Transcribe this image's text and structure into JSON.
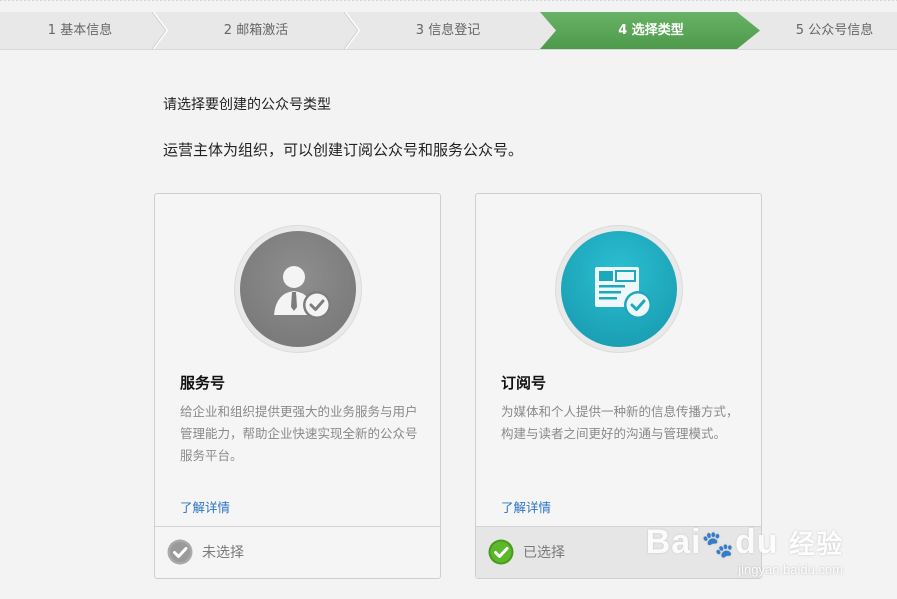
{
  "steps": [
    {
      "label": "1 基本信息"
    },
    {
      "label": "2 邮箱激活"
    },
    {
      "label": "3 信息登记"
    },
    {
      "label": "4 选择类型"
    },
    {
      "label": "5 公众号信息"
    }
  ],
  "active_step_color": "#5aa658",
  "intro": {
    "line1": "请选择要创建的公众号类型",
    "line2": "运营主体为组织，可以创建订阅公众号和服务公众号。"
  },
  "cards": [
    {
      "title": "服务号",
      "desc": "给企业和组织提供更强大的业务服务与用户管理能力，帮助企业快速实现全新的公众号服务平台。",
      "more": "了解详情",
      "status": "未选择",
      "icon": "service-account-icon",
      "icon_color": "#7d7d7d",
      "selected": false
    },
    {
      "title": "订阅号",
      "desc": "为媒体和个人提供一种新的信息传播方式，构建与读者之间更好的沟通与管理模式。",
      "more": "了解详情",
      "status": "已选择",
      "icon": "subscription-account-icon",
      "icon_color": "#1ea8be",
      "selected": true
    }
  ],
  "watermark": {
    "brand": "Bai",
    "brand_tail": "du",
    "cn": "经验",
    "url": "jingyan.baidu.com"
  }
}
